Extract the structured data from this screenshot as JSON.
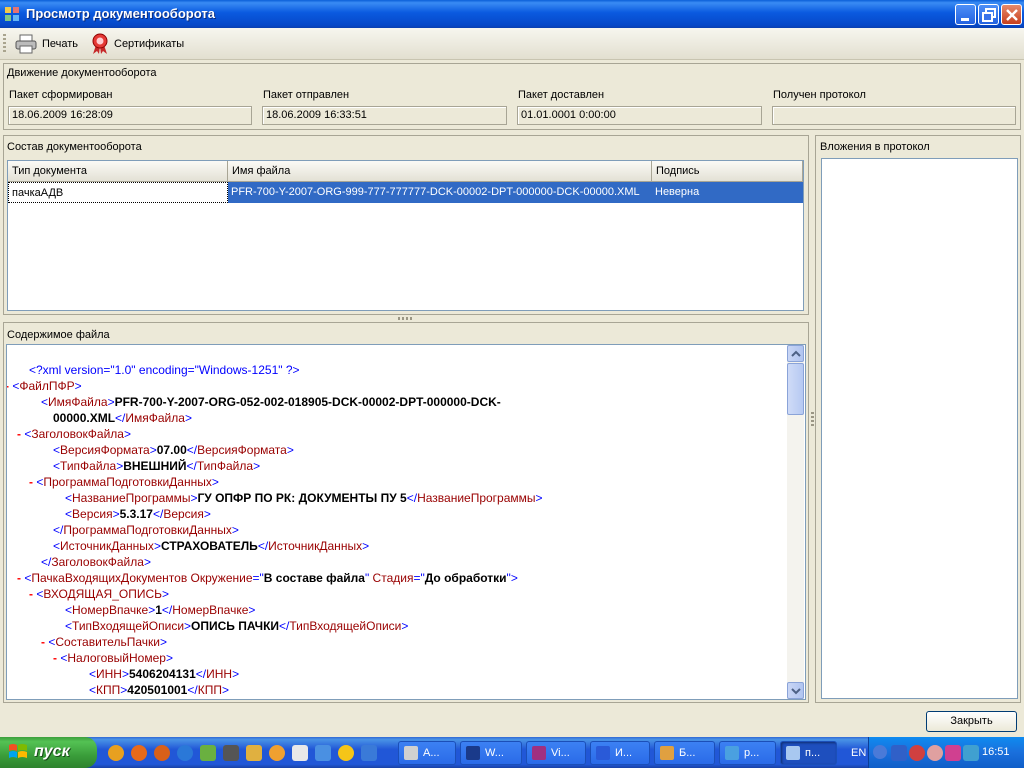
{
  "window": {
    "title": "Просмотр документооборота"
  },
  "toolbar": {
    "print_label": "Печать",
    "certs_label": "Сертификаты"
  },
  "movement": {
    "group_label": "Движение документооборота",
    "fields": [
      {
        "label": "Пакет сформирован",
        "value": "18.06.2009 16:28:09"
      },
      {
        "label": "Пакет отправлен",
        "value": "18.06.2009 16:33:51"
      },
      {
        "label": "Пакет доставлен",
        "value": "01.01.0001 0:00:00"
      },
      {
        "label": "Получен протокол",
        "value": ""
      }
    ]
  },
  "composition": {
    "group_label": "Состав документооборота",
    "columns": [
      "Тип документа",
      "Имя файла",
      "Подпись"
    ],
    "rows": [
      {
        "type": "пачкаАДВ",
        "file": "PFR-700-Y-2007-ORG-999-777-777777-DCK-00002-DPT-000000-DCK-00000.XML",
        "sign": "Неверна"
      }
    ]
  },
  "attachments": {
    "group_label": "Вложения в протокол"
  },
  "content": {
    "group_label": "Содержимое файла",
    "lines": [
      {
        "pi": "<?xml version=\"1.0\" encoding=\"Windows-1251\" ?>"
      },
      {
        "open": "ФайлПФР"
      },
      {
        "open": "ИмяФайла",
        "value": "PFR-700-Y-2007-ORG-052-002-018905-DCK-00002-DPT-000000-DCK-",
        "value2": "00000.XML",
        "close": "ИмяФайла"
      },
      {
        "open": "ЗаголовокФайла"
      },
      {
        "open": "ВерсияФормата",
        "value": "07.00",
        "close": "ВерсияФормата"
      },
      {
        "open": "ТипФайла",
        "value": "ВНЕШНИЙ",
        "close": "ТипФайла"
      },
      {
        "open": "ПрограммаПодготовкиДанных"
      },
      {
        "open": "НазваниеПрограммы",
        "value": "ГУ ОПФР ПО РК: ДОКУМЕНТЫ ПУ 5",
        "close": "НазваниеПрограммы"
      },
      {
        "open": "Версия",
        "value": "5.3.17",
        "close": "Версия"
      },
      {
        "close": "ПрограммаПодготовкиДанных"
      },
      {
        "open": "ИсточникДанных",
        "value": "СТРАХОВАТЕЛЬ",
        "close": "ИсточникДанных"
      },
      {
        "close": "ЗаголовокФайла"
      },
      {
        "open": "ПачкаВходящихДокументов",
        "attr1": "Окружение",
        "attr1_val": "В составе файла",
        "attr2": "Стадия",
        "attr2_val": "До обработки"
      },
      {
        "open": "ВХОДЯЩАЯ_ОПИСЬ"
      },
      {
        "open": "НомерВпачке",
        "value": "1",
        "close": "НомерВпачке"
      },
      {
        "open": "ТипВходящейОписи",
        "value": "ОПИСЬ ПАЧКИ",
        "close": "ТипВходящейОписи"
      },
      {
        "open": "СоставительПачки"
      },
      {
        "open": "НалоговыйНомер"
      },
      {
        "open": "ИНН",
        "value": "5406204131",
        "close": "ИНН"
      },
      {
        "open": "КПП",
        "value": "420501001",
        "close": "КПП"
      }
    ]
  },
  "close_button": "Закрыть",
  "taskbar": {
    "start_label": "пуск",
    "buttons": [
      "А...",
      "W...",
      "Vi...",
      "И...",
      "Б...",
      "р...",
      "п..."
    ],
    "language": "EN",
    "clock": "16:51"
  },
  "colors": {
    "title_bar": "#0a5ae0",
    "selection": "#316ac5",
    "xml_tag": "#990000",
    "xml_pi": "#0000ff",
    "xml_minus": "#ff0000"
  }
}
